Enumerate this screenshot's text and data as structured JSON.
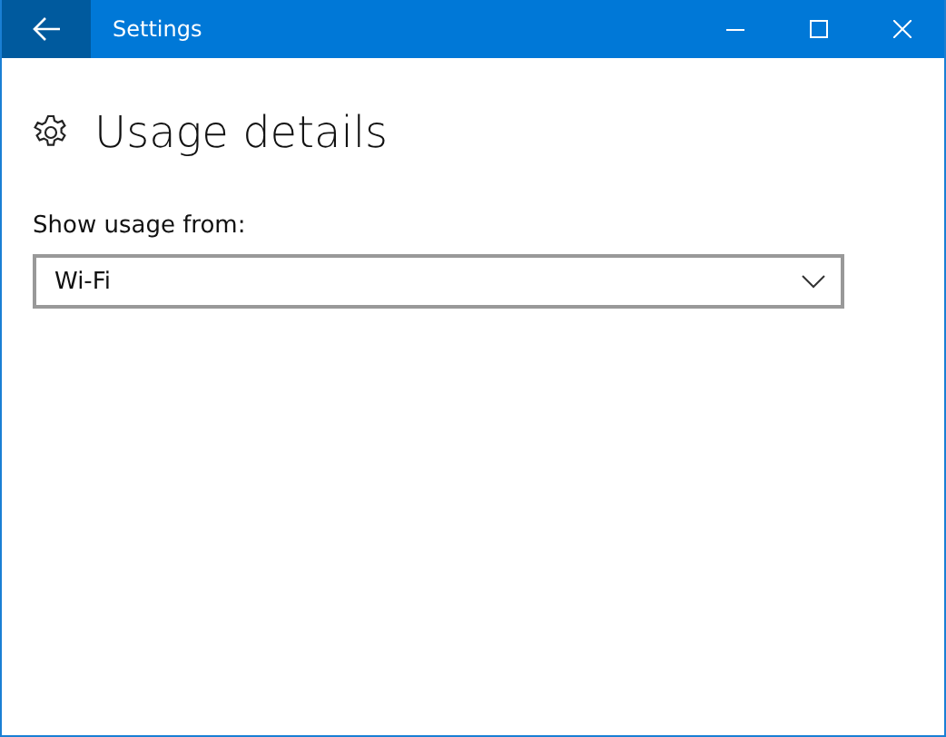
{
  "window": {
    "title": "Settings"
  },
  "page": {
    "title": "Usage details"
  },
  "usage_source": {
    "label": "Show usage from:",
    "value": "Wi-Fi"
  }
}
